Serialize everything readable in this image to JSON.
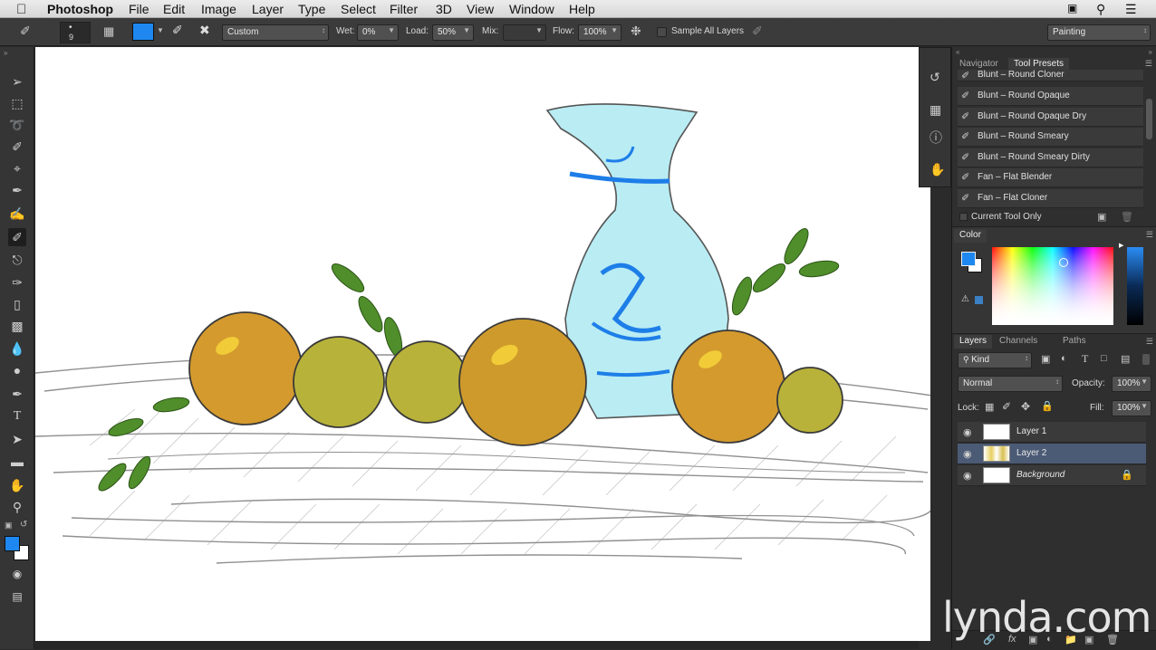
{
  "menubar": {
    "app_name": "Photoshop",
    "items": [
      "File",
      "Edit",
      "Image",
      "Layer",
      "Type",
      "Select",
      "Filter",
      "3D",
      "View",
      "Window",
      "Help"
    ]
  },
  "options_bar": {
    "brush_size": "9",
    "foreground_color": "#1e88f0",
    "brush_preset_value": "Custom",
    "wet_label": "Wet:",
    "wet_value": "0%",
    "load_label": "Load:",
    "load_value": "50%",
    "mix_label": "Mix:",
    "mix_value": "",
    "flow_label": "Flow:",
    "flow_value": "100%",
    "sample_all_layers_label": "Sample All Layers",
    "workspace_value": "Painting"
  },
  "tools": [
    "move-tool",
    "marquee-tool",
    "lasso-tool",
    "quick-selection-tool",
    "crop-tool",
    "eyedropper-tool",
    "healing-brush-tool",
    "mixer-brush-tool",
    "clone-stamp-tool",
    "history-brush-tool",
    "eraser-tool",
    "gradient-tool",
    "blur-tool",
    "dodge-tool",
    "pen-tool",
    "type-tool",
    "path-selection-tool",
    "rectangle-tool",
    "hand-tool",
    "zoom-tool"
  ],
  "tool_presets_panel": {
    "tabs": [
      "Navigator",
      "Tool Presets"
    ],
    "active_tab": "Tool Presets",
    "presets": [
      "Blunt – Round Cloner",
      "Blunt – Round Opaque",
      "Blunt – Round Opaque Dry",
      "Blunt – Round Smeary",
      "Blunt – Round Smeary Dirty",
      "Fan – Flat Blender",
      "Fan – Flat Cloner"
    ],
    "current_tool_only_label": "Current Tool Only"
  },
  "color_panel": {
    "title": "Color",
    "foreground": "#1e88f0",
    "background": "#ffffff"
  },
  "layers_panel": {
    "tabs": [
      "Layers",
      "Channels",
      "Paths"
    ],
    "active_tab": "Layers",
    "filter_label": "Kind",
    "blend_mode": "Normal",
    "opacity_label": "Opacity:",
    "opacity_value": "100%",
    "lock_label": "Lock:",
    "fill_label": "Fill:",
    "fill_value": "100%",
    "layers": [
      {
        "name": "Layer 1",
        "selected": false,
        "locked": false
      },
      {
        "name": "Layer 2",
        "selected": true,
        "locked": false
      },
      {
        "name": "Background",
        "selected": false,
        "locked": true
      }
    ]
  },
  "watermark": "lynda.com",
  "colors": {
    "accent": "#1e88f0",
    "selected_layer": "#4b5a75",
    "panel_bg": "#2f2f2f"
  }
}
